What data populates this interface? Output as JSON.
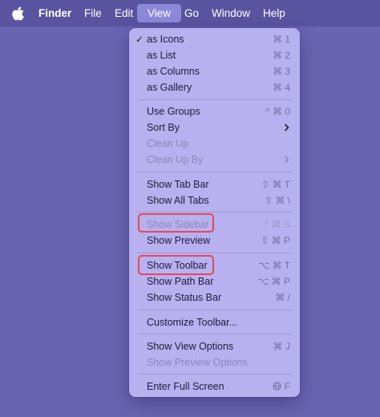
{
  "menubar": {
    "app_name": "Finder",
    "items": [
      "File",
      "Edit",
      "View",
      "Go",
      "Window",
      "Help"
    ]
  },
  "menu": {
    "items": [
      {
        "label": "as Icons",
        "shortcut": "⌘ 1",
        "checked": true
      },
      {
        "label": "as List",
        "shortcut": "⌘ 2"
      },
      {
        "label": "as Columns",
        "shortcut": "⌘ 3"
      },
      {
        "label": "as Gallery",
        "shortcut": "⌘ 4"
      },
      {
        "label": "Use Groups",
        "shortcut": "^ ⌘ 0"
      },
      {
        "label": "Sort By"
      },
      {
        "label": "Clean Up",
        "disabled": true
      },
      {
        "label": "Clean Up By",
        "disabled": true
      },
      {
        "label": "Show Tab Bar",
        "shortcut": "⇧ ⌘ T"
      },
      {
        "label": "Show All Tabs",
        "shortcut": "⇧ ⌘ \\"
      },
      {
        "label": "Show Sidebar",
        "shortcut": "^ ⌘ S",
        "disabled": true
      },
      {
        "label": "Show Preview",
        "shortcut": "⇧ ⌘ P"
      },
      {
        "label": "Show Toolbar",
        "shortcut": "⌥ ⌘ T"
      },
      {
        "label": "Show Path Bar",
        "shortcut": "⌥ ⌘ P"
      },
      {
        "label": "Show Status Bar",
        "shortcut": "⌘ /"
      },
      {
        "label": "Customize Toolbar..."
      },
      {
        "label": "Show View Options",
        "shortcut": "⌘ J"
      },
      {
        "label": "Show Preview Options",
        "disabled": true
      },
      {
        "label": "Enter Full Screen",
        "shortcut": "F"
      }
    ]
  },
  "colors": {
    "desktop": "#6a64b0",
    "menubar": "#5a53a0",
    "menu": "#b7b1ef",
    "highlight_box": "#e8455c"
  }
}
